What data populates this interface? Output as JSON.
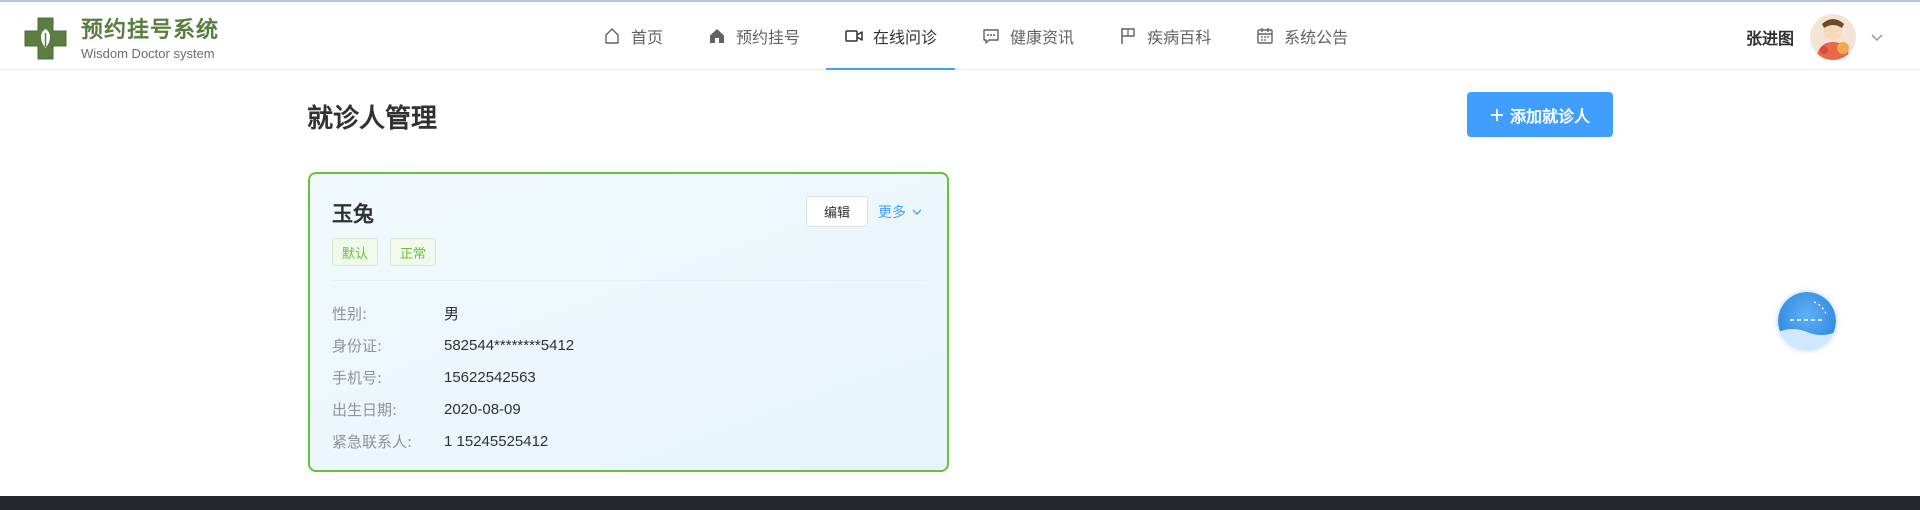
{
  "header": {
    "brand_title": "预约挂号系统",
    "brand_subtitle": "Wisdom Doctor system",
    "brand_color": "#5b7d42",
    "nav": [
      {
        "label": "首页",
        "icon": "home-outline-icon",
        "active": false
      },
      {
        "label": "预约挂号",
        "icon": "home-filled-icon",
        "active": false
      },
      {
        "label": "在线问诊",
        "icon": "video-camera-icon",
        "active": true
      },
      {
        "label": "健康资讯",
        "icon": "chat-bubble-icon",
        "active": false
      },
      {
        "label": "疾病百科",
        "icon": "flag-icon",
        "active": false
      },
      {
        "label": "系统公告",
        "icon": "calendar-icon",
        "active": false
      }
    ],
    "user_name": "张进图"
  },
  "main": {
    "page_title": "就诊人管理",
    "add_button_label": "添加就诊人",
    "accent_color": "#409eff"
  },
  "patient": {
    "name": "玉兔",
    "tags": [
      "默认",
      "正常"
    ],
    "edit_label": "编辑",
    "more_label": "更多",
    "fields": [
      {
        "label": "性别:",
        "value": "男"
      },
      {
        "label": "身份证:",
        "value": "582544********5412"
      },
      {
        "label": "手机号:",
        "value": "15622542563"
      },
      {
        "label": "出生日期:",
        "value": "2020-08-09"
      },
      {
        "label": "紧急联系人:",
        "value": "1 15245525412"
      }
    ],
    "status_color": "#67c23a"
  }
}
